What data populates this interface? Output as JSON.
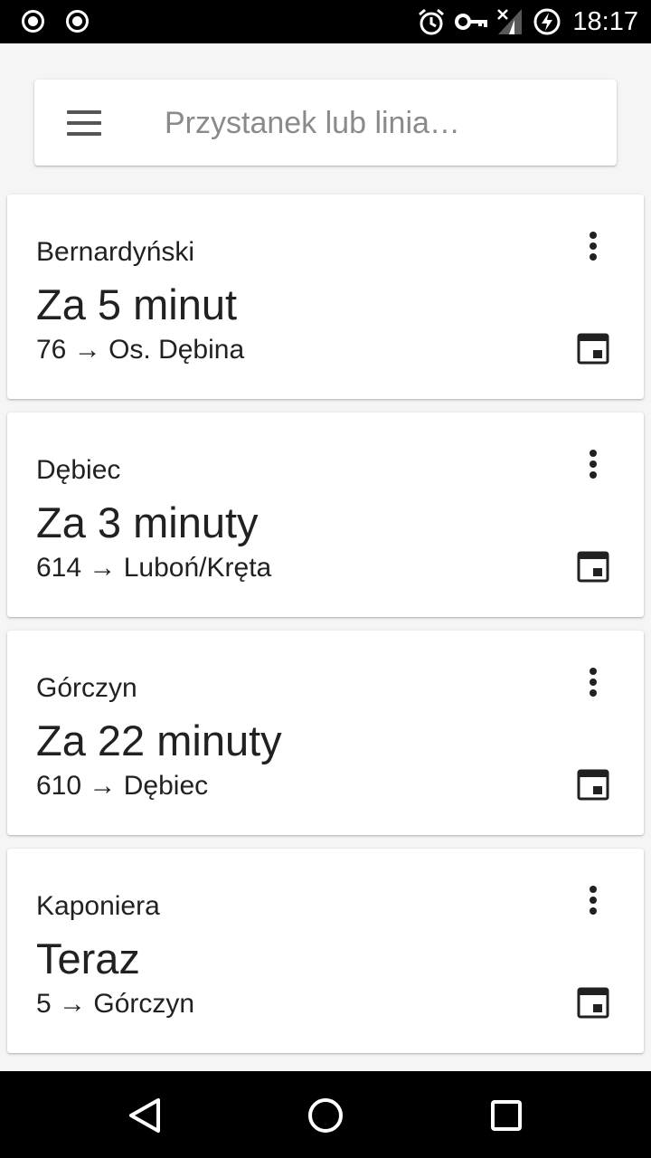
{
  "status_bar": {
    "time": "18:17",
    "icons": [
      "notification-dot-icon",
      "notification-dot-icon",
      "alarm-icon",
      "vpn-key-icon",
      "signal-icon",
      "battery-charging-icon"
    ]
  },
  "search": {
    "placeholder": "Przystanek lub linia…",
    "value": ""
  },
  "departures": [
    {
      "stop": "Bernardyński",
      "eta": "Za 5 minut",
      "line": "76",
      "arrow": "→",
      "destination": "Os. Dębina"
    },
    {
      "stop": "Dębiec",
      "eta": "Za 3 minuty",
      "line": "614",
      "arrow": "→",
      "destination": "Luboń/Kręta"
    },
    {
      "stop": "Górczyn",
      "eta": "Za 22 minuty",
      "line": "610",
      "arrow": "→",
      "destination": "Dębiec"
    },
    {
      "stop": "Kaponiera",
      "eta": "Teraz",
      "line": "5",
      "arrow": "→",
      "destination": "Górczyn"
    }
  ],
  "navigation": [
    "back-icon",
    "home-icon",
    "recents-icon"
  ]
}
